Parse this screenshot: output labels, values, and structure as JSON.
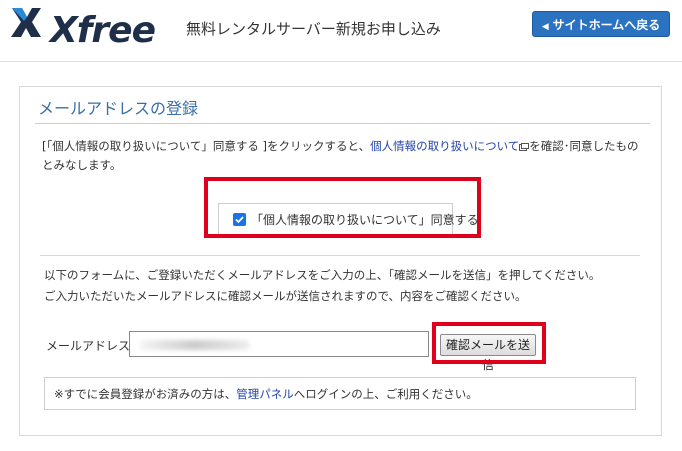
{
  "header": {
    "logo_text": "Xfree",
    "title": "無料レンタルサーバー新規お申し込み",
    "back_button": "サイトホームへ戻る",
    "back_icon": "chevron-left-icon"
  },
  "panel": {
    "title": "メールアドレスの登録",
    "consent_text": {
      "part1": "[「個人情報の取り扱いについて」同意する ]をクリックすると、",
      "link": "個人情報の取り扱いについて",
      "part2": "を確認･同意したものとみなします。"
    },
    "consent_checkbox": {
      "label": "「個人情報の取り扱いについて」同意する",
      "checked": true
    },
    "instructions": [
      "以下のフォームに、ご登録いただくメールアドレスをご入力の上、「確認メールを送信」を押してください。",
      "ご入力いただいたメールアドレスに確認メールが送信されますので、内容をご確認ください。"
    ],
    "email": {
      "label": "メールアドレス:",
      "value": ""
    },
    "send_button": "確認メールを送信",
    "notice": {
      "part1": "※すでに会員登録がお済みの方は、",
      "link": "管理パネル",
      "part2": "へログインの上、ご利用ください。"
    }
  },
  "colors": {
    "accent": "#2b72c0",
    "highlight": "#e0001b",
    "title": "#3a6ea8",
    "link": "#2244aa"
  }
}
